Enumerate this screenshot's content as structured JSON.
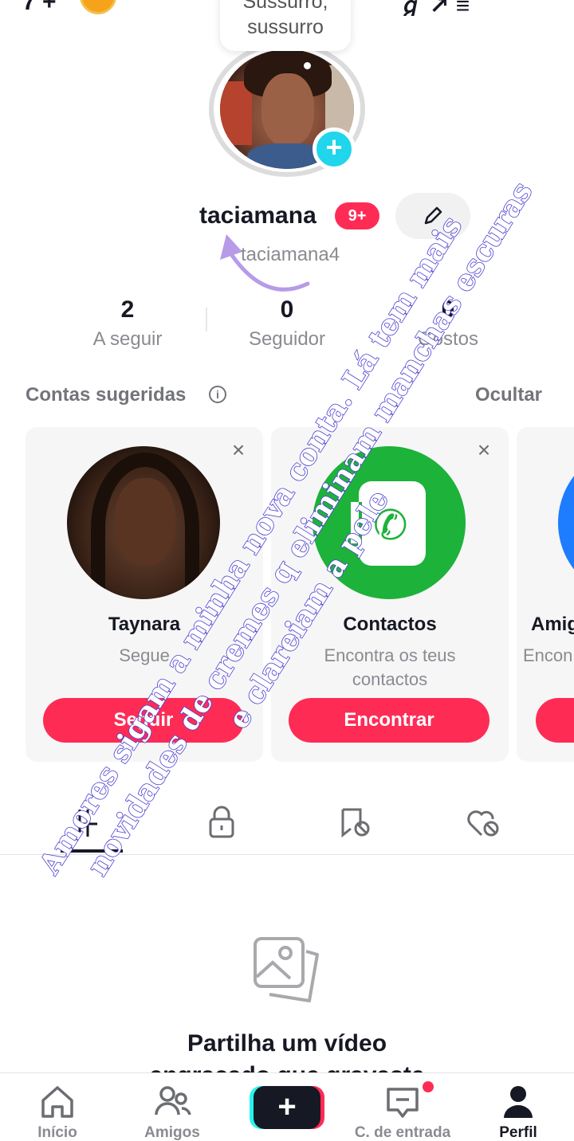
{
  "status_bar": {
    "left_text": "7 +",
    "right_text": "ℊ ↗ ≡"
  },
  "note": {
    "text_line1": "Sussurro,",
    "text_line2": "sussurro"
  },
  "profile": {
    "username": "taciamana",
    "notification_badge": "9+",
    "handle": "taciamana4",
    "stats": [
      {
        "value": "2",
        "label": "A seguir"
      },
      {
        "value": "0",
        "label": "Seguidor"
      },
      {
        "value": "0",
        "label": "Gostos"
      }
    ]
  },
  "suggested": {
    "title": "Contas sugeridas",
    "hide_label": "Ocultar",
    "cards": [
      {
        "name": "Taynara",
        "subtitle": "Segue",
        "button": "Seguir"
      },
      {
        "name": "Contactos",
        "subtitle_line1": "Encontra os teus",
        "subtitle_line2": "contactos",
        "button": "Encontrar"
      },
      {
        "name": "Amig",
        "subtitle": "Encon"
      }
    ]
  },
  "tabs": [
    "videos-grid-icon",
    "lock-icon",
    "repost-icon",
    "liked-icon"
  ],
  "empty_state": {
    "title_line1": "Partilha um vídeo",
    "title_line2": "engraçado que gravaste"
  },
  "overlay_text": {
    "line1": "Amores sigam a minha nova conta. Lá tem mais",
    "line2": "novidades de cremes q eliminam manchas escuras",
    "line3": "e clareiam a pele"
  },
  "bottom_nav": [
    {
      "label": "Início",
      "icon": "home-icon"
    },
    {
      "label": "Amigos",
      "icon": "friends-icon"
    },
    {
      "label": "",
      "icon": "create-icon"
    },
    {
      "label": "C. de entrada",
      "icon": "inbox-icon"
    },
    {
      "label": "Perfil",
      "icon": "profile-icon"
    }
  ],
  "colors": {
    "accent": "#fe2c55",
    "cyan": "#20d5ec",
    "text": "#161823",
    "muted": "#8a8b91",
    "overlay_text": "#4a3fd0"
  }
}
